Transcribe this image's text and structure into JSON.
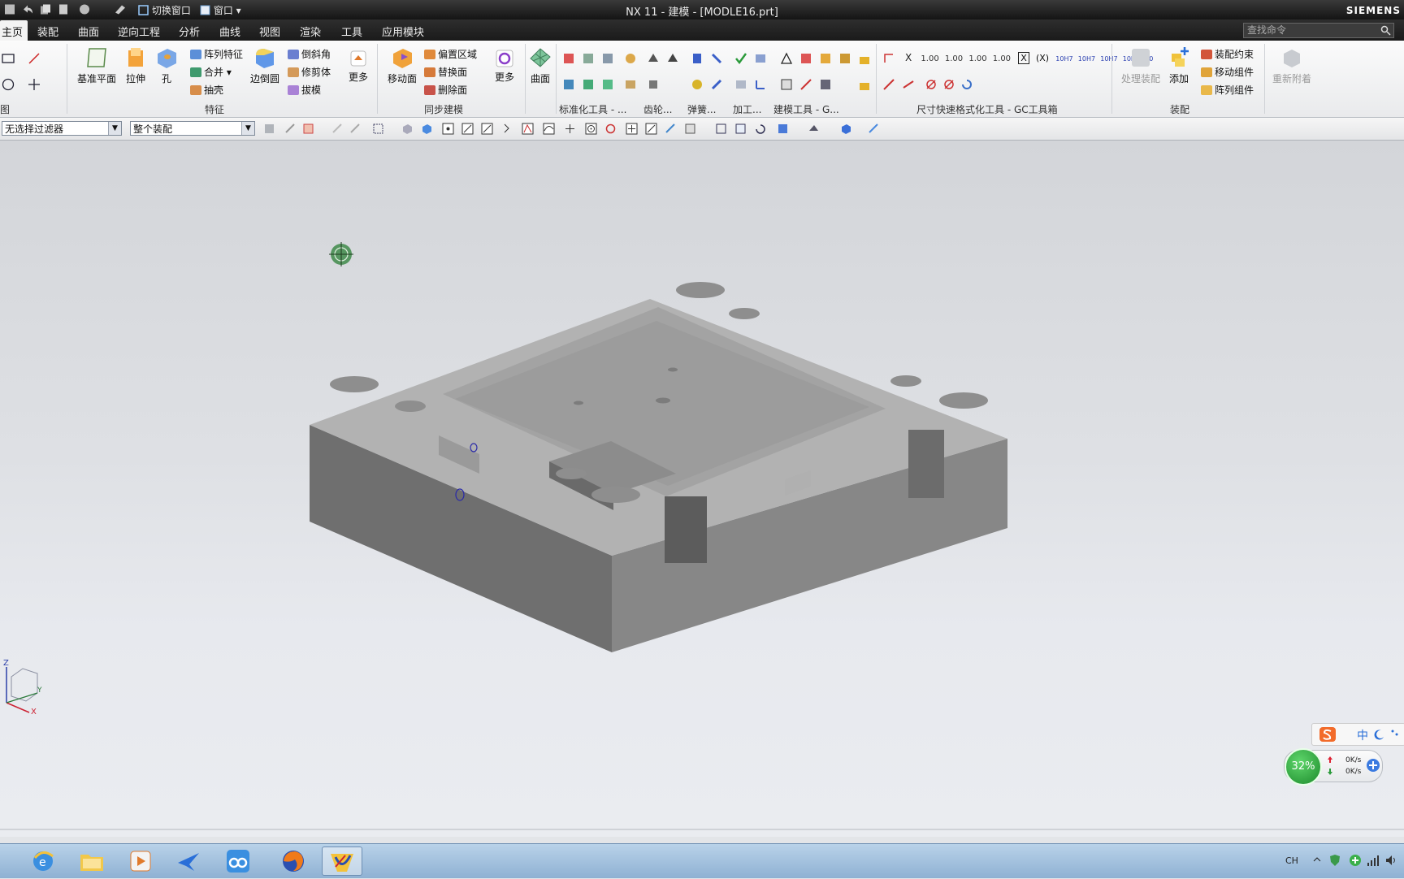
{
  "title_bar": {
    "switch_window_label": "切换窗口",
    "window_menu_label": "窗口",
    "title": "NX 11 - 建模 - [MODLE16.prt]",
    "brand": "SIEMENS"
  },
  "menu": {
    "tabs": [
      "主页",
      "装配",
      "曲面",
      "逆向工程",
      "分析",
      "曲线",
      "视图",
      "渲染",
      "工具",
      "应用模块"
    ],
    "search_placeholder": "查找命令"
  },
  "ribbon": {
    "feature": {
      "datum_plane": "基准平面",
      "extrude": "拉伸",
      "hole": "孔",
      "pattern_feature": "阵列特征",
      "unite": "合并",
      "shell": "抽壳",
      "edge_blend": "边倒圆",
      "chamfer": "倒斜角",
      "trim_body": "修剪体",
      "draft": "拔模",
      "more": "更多",
      "group_label": "特征"
    },
    "sync": {
      "move_face": "移动面",
      "offset_region": "偏置区域",
      "replace_face": "替换面",
      "delete_face": "删除面",
      "more": "更多",
      "group_label": "同步建模"
    },
    "surface": {
      "label": "曲面"
    },
    "groups": {
      "standard_tools": "标准化工具 - ...",
      "gears": "齿轮...",
      "springs": "弹簧...",
      "machining": "加工...",
      "modeling_tools": "建模工具 - G...",
      "dim_tools": "尺寸快速格式化工具 - GC工具箱",
      "assembly": "装配",
      "left_partial": "图"
    },
    "dim_icons": [
      "X",
      "1.00",
      "1.00",
      "1.00",
      "1.00",
      "X",
      "(X)",
      "10H7",
      "10H7",
      "10H7",
      "10H7",
      "10"
    ],
    "assembly": {
      "process_assembly": "处理装配",
      "add": "添加",
      "assembly_constraints": "装配约束",
      "move_component": "移动组件",
      "pattern_component": "阵列组件",
      "reattach": "重新附着"
    }
  },
  "filter_bar": {
    "selection_filter": "无选择过滤器",
    "scope": "整个装配"
  },
  "csys": {
    "x": "X",
    "y": "Y",
    "z": "Z"
  },
  "speed_widget": {
    "percent": "32%",
    "up": "0K/s",
    "down": "0K/s"
  },
  "ime": {
    "mode": "中"
  },
  "taskbar": {
    "apps": [
      "internet-explorer",
      "file-explorer",
      "media-player",
      "feiq",
      "baidu-netdisk",
      "firefox",
      "siemens-nx"
    ],
    "tray_lang": "CH"
  },
  "colors": {
    "title_bar": "#1e1e1e",
    "ribbon_bg": "#f3f3f3",
    "viewport_bg": "#dee0e4",
    "part_top": "#b5b5b5",
    "part_left": "#909090",
    "part_right": "#7b7b7b",
    "taskbar": "#a8c4e0"
  }
}
